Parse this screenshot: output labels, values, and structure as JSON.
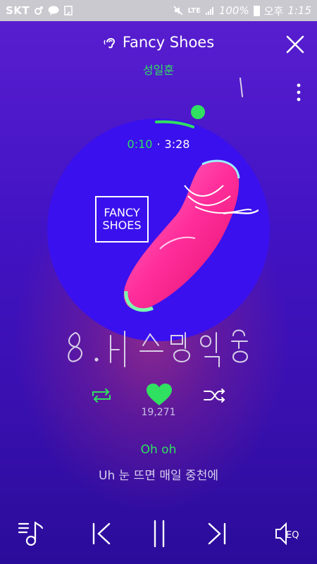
{
  "status_bar": {
    "carrier": "SKT",
    "network": "LTE",
    "battery": "100%",
    "ampm": "오후",
    "time": "1:15"
  },
  "player": {
    "title": "Fancy Shoes",
    "artist": "성일훈",
    "current_time": "0:10",
    "separator": "·",
    "total_time": "3:28",
    "progress": 0.048
  },
  "album_art": {
    "line1": "FANCY",
    "line2": "SHOES"
  },
  "likes": "19,271",
  "lyrics": {
    "current": "Oh oh",
    "next": "Uh 눈 뜨면 매일 중천에"
  },
  "bottom": {
    "eq_label": "EQ"
  },
  "colors": {
    "accent_green": "#30e060",
    "background": "#4213c4",
    "album_bg": "#3a10ee",
    "shoe": "#ff3da0"
  }
}
